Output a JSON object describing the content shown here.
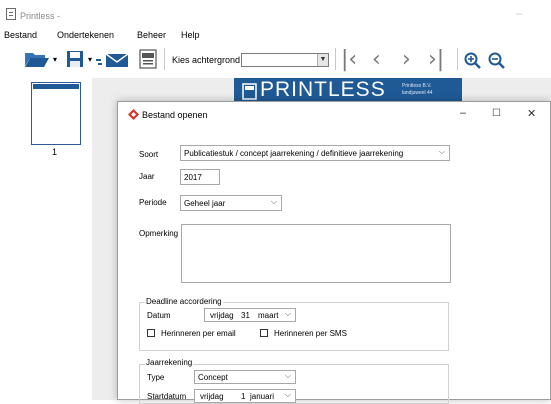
{
  "app": {
    "title": "Printless -"
  },
  "menu": {
    "items": [
      "Bestand",
      "Ondertekenen",
      "Beheer",
      "Help"
    ]
  },
  "toolbar": {
    "background_label": "Kies achtergrond",
    "background_value": "",
    "nav": [
      "|<",
      "<",
      ">",
      ">|"
    ],
    "zoom_in_icon": "zoom-in-icon",
    "zoom_out_icon": "zoom-out-icon"
  },
  "pages_panel": {
    "thumb_label": "1"
  },
  "banner": {
    "logo_text": "PRINTLESS",
    "small_line1": "Printless B.V.",
    "small_line2": "landjuweel 44"
  },
  "dialog": {
    "title": "Bestand openen",
    "soort_label": "Soort",
    "soort_value": "Publicatiestuk / concept jaarrekening / definitieve jaarrekening",
    "jaar_label": "Jaar",
    "jaar_value": "2017",
    "periode_label": "Periode",
    "periode_value": "Geheel jaar",
    "opmerking_label": "Opmerking",
    "opmerking_value": "",
    "deadline": {
      "group_title": "Deadline accordering",
      "datum_label": "Datum",
      "datum_day": "vrijdag",
      "datum_num": "31",
      "datum_month": "maart",
      "email_label": "Herinneren per email",
      "sms_label": "Herinneren per SMS",
      "email_checked": false,
      "sms_checked": false
    },
    "jaarrekening": {
      "group_title": "Jaarrekening",
      "type_label": "Type",
      "type_value": "Concept",
      "start_label": "Startdatum",
      "start_day": "vrijdag",
      "start_num": "1",
      "start_month": "januari"
    }
  },
  "colors": {
    "brand": "#1f5a96",
    "workspace": "#ededed",
    "dialog_icon": "#d9342b"
  }
}
